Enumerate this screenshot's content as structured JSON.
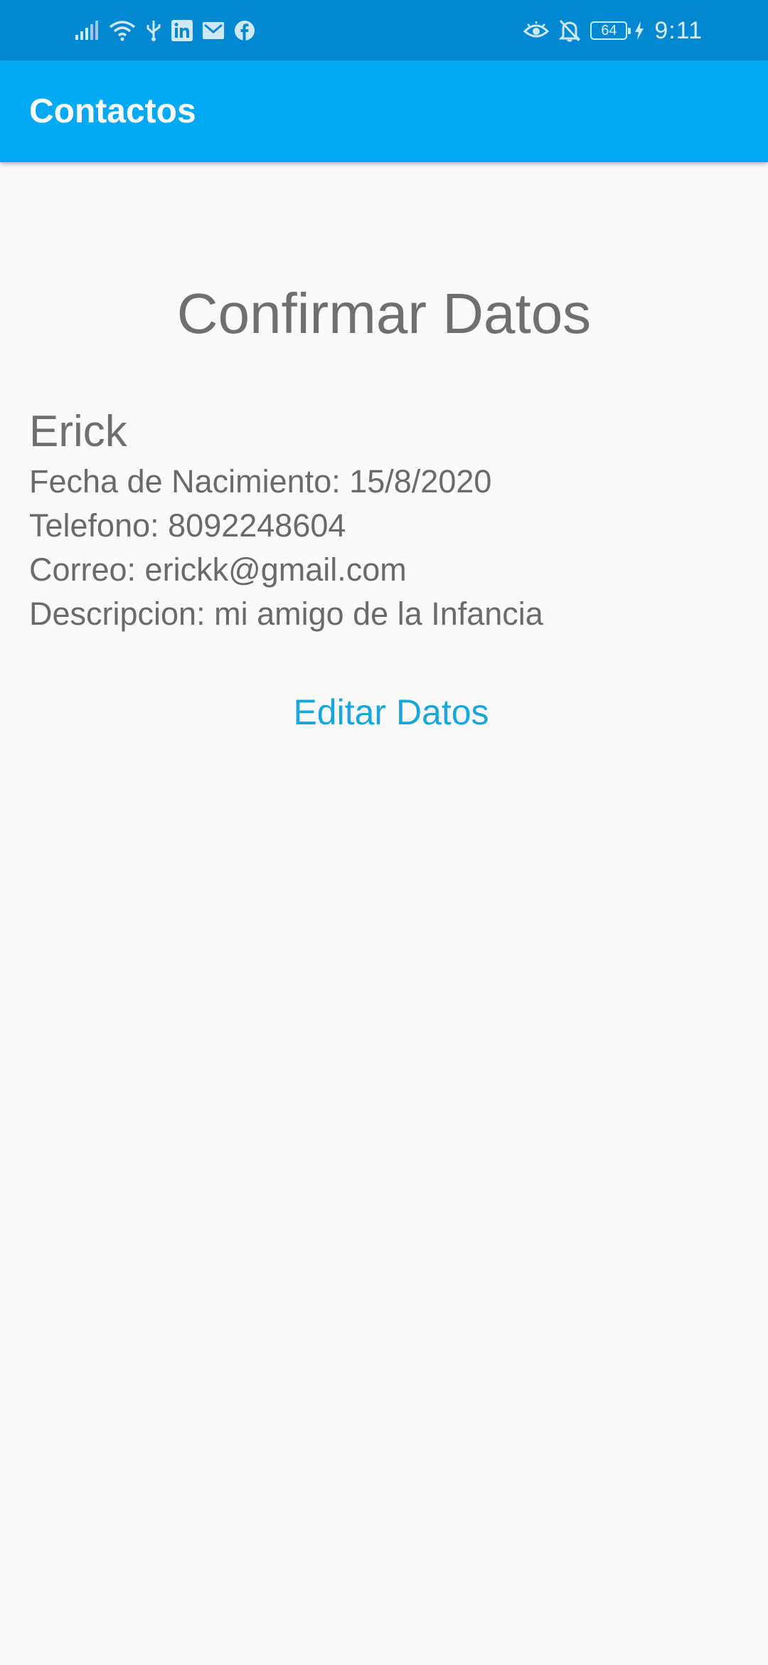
{
  "status_bar": {
    "left_icons": [
      "signal-icon",
      "wifi-icon",
      "usb-icon",
      "linkedin-icon",
      "gmail-icon",
      "facebook-icon"
    ],
    "right_icons": [
      "eye-comfort-icon",
      "notifications-off-icon",
      "battery-icon",
      "charging-icon"
    ],
    "battery_level": "64",
    "time": "9:11",
    "background_color": "#0288d1"
  },
  "app_bar": {
    "title": "Contactos",
    "background_color": "#03a9f4"
  },
  "main": {
    "heading": "Confirmar Datos",
    "contact": {
      "name": "Erick",
      "birth_date_line": "Fecha de Nacimiento: 15/8/2020",
      "phone_line": "Telefono: 8092248604",
      "email_line": "Correo: erickk@gmail.com",
      "description_line": "Descripcion: mi amigo de la Infancia"
    },
    "edit_button_label": "Editar Datos",
    "accent_color": "#1ba6db"
  }
}
